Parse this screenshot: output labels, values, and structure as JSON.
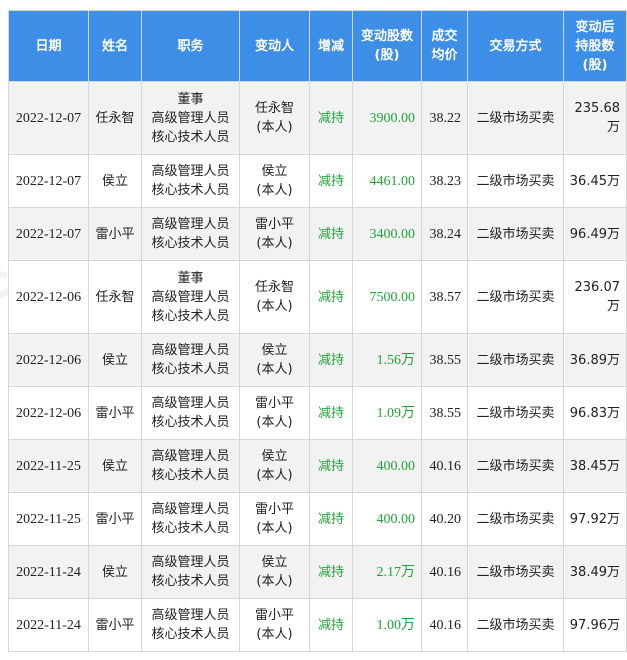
{
  "headers": {
    "date": "日期",
    "name": "姓名",
    "position": "职务",
    "changer": "变动人",
    "direction": "增减",
    "shares": [
      "变动股数",
      "(股)"
    ],
    "price": [
      "成交",
      "均价"
    ],
    "method": "交易方式",
    "after": [
      "变动后",
      "持股数",
      "(股)"
    ]
  },
  "rows": [
    {
      "date": "2022-12-07",
      "name": "任永智",
      "position": [
        "董事",
        "高级管理人员",
        "核心技术人员"
      ],
      "changer": [
        "任永智",
        "(本人)"
      ],
      "direction": "减持",
      "shares": "3900.00",
      "price": "38.22",
      "method": "二级市场买卖",
      "after": "235.68万"
    },
    {
      "date": "2022-12-07",
      "name": "侯立",
      "position": [
        "高级管理人员",
        "核心技术人员"
      ],
      "changer": [
        "侯立",
        "(本人)"
      ],
      "direction": "减持",
      "shares": "4461.00",
      "price": "38.23",
      "method": "二级市场买卖",
      "after": "36.45万"
    },
    {
      "date": "2022-12-07",
      "name": "雷小平",
      "position": [
        "高级管理人员",
        "核心技术人员"
      ],
      "changer": [
        "雷小平",
        "(本人)"
      ],
      "direction": "减持",
      "shares": "3400.00",
      "price": "38.24",
      "method": "二级市场买卖",
      "after": "96.49万"
    },
    {
      "date": "2022-12-06",
      "name": "任永智",
      "position": [
        "董事",
        "高级管理人员",
        "核心技术人员"
      ],
      "changer": [
        "任永智",
        "(本人)"
      ],
      "direction": "减持",
      "shares": "7500.00",
      "price": "38.57",
      "method": "二级市场买卖",
      "after": "236.07万"
    },
    {
      "date": "2022-12-06",
      "name": "侯立",
      "position": [
        "高级管理人员",
        "核心技术人员"
      ],
      "changer": [
        "侯立",
        "(本人)"
      ],
      "direction": "减持",
      "shares": "1.56万",
      "price": "38.55",
      "method": "二级市场买卖",
      "after": "36.89万"
    },
    {
      "date": "2022-12-06",
      "name": "雷小平",
      "position": [
        "高级管理人员",
        "核心技术人员"
      ],
      "changer": [
        "雷小平",
        "(本人)"
      ],
      "direction": "减持",
      "shares": "1.09万",
      "price": "38.55",
      "method": "二级市场买卖",
      "after": "96.83万"
    },
    {
      "date": "2022-11-25",
      "name": "侯立",
      "position": [
        "高级管理人员",
        "核心技术人员"
      ],
      "changer": [
        "侯立",
        "(本人)"
      ],
      "direction": "减持",
      "shares": "400.00",
      "price": "40.16",
      "method": "二级市场买卖",
      "after": "38.45万"
    },
    {
      "date": "2022-11-25",
      "name": "雷小平",
      "position": [
        "高级管理人员",
        "核心技术人员"
      ],
      "changer": [
        "雷小平",
        "(本人)"
      ],
      "direction": "减持",
      "shares": "400.00",
      "price": "40.20",
      "method": "二级市场买卖",
      "after": "97.92万"
    },
    {
      "date": "2022-11-24",
      "name": "侯立",
      "position": [
        "高级管理人员",
        "核心技术人员"
      ],
      "changer": [
        "侯立",
        "(本人)"
      ],
      "direction": "减持",
      "shares": "2.17万",
      "price": "40.16",
      "method": "二级市场买卖",
      "after": "38.49万"
    },
    {
      "date": "2022-11-24",
      "name": "雷小平",
      "position": [
        "高级管理人员",
        "核心技术人员"
      ],
      "changer": [
        "雷小平",
        "(本人)"
      ],
      "direction": "减持",
      "shares": "1.00万",
      "price": "40.16",
      "method": "二级市场买卖",
      "after": "97.96万"
    }
  ],
  "colors": {
    "header_bg": "#3c8ee6",
    "header_text": "#ffffff",
    "change_text": "#22a33a"
  },
  "watermark": "证券之星"
}
